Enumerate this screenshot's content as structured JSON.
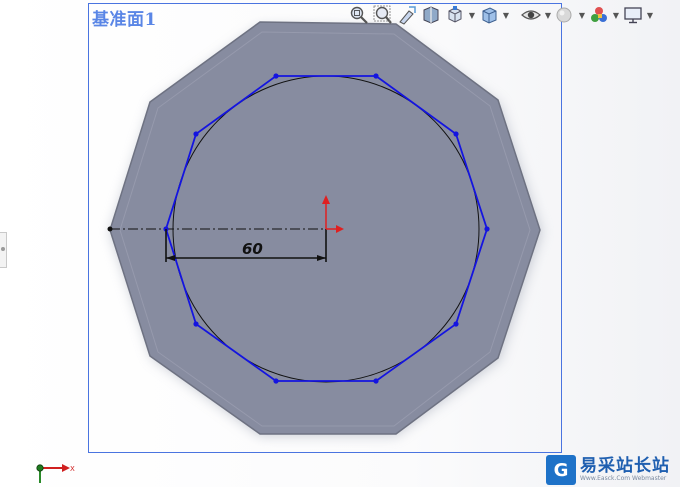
{
  "plane": {
    "label": "基准面1"
  },
  "sketch": {
    "dimension": "60",
    "colors": {
      "model_face": "#8a8fa3",
      "model_edge": "#6e7282",
      "sketch_line": "#1414e0",
      "construction": "#111111",
      "origin_red": "#e02020",
      "plane_border": "#4a74e0"
    }
  },
  "toolbar": {
    "icons": [
      "zoom-to-fit-icon",
      "zoom-area-icon",
      "previous-view-icon",
      "section-view-icon",
      "view-orientation-icon",
      "display-style-icon",
      "hide-show-items-icon",
      "edit-appearance-icon",
      "apply-scene-icon",
      "view-settings-icon"
    ]
  },
  "triad": {
    "x_label": "X"
  },
  "watermark": {
    "logo": "G",
    "title": "易采站长站",
    "subtitle": "Www.Easck.Com Webmaster"
  }
}
